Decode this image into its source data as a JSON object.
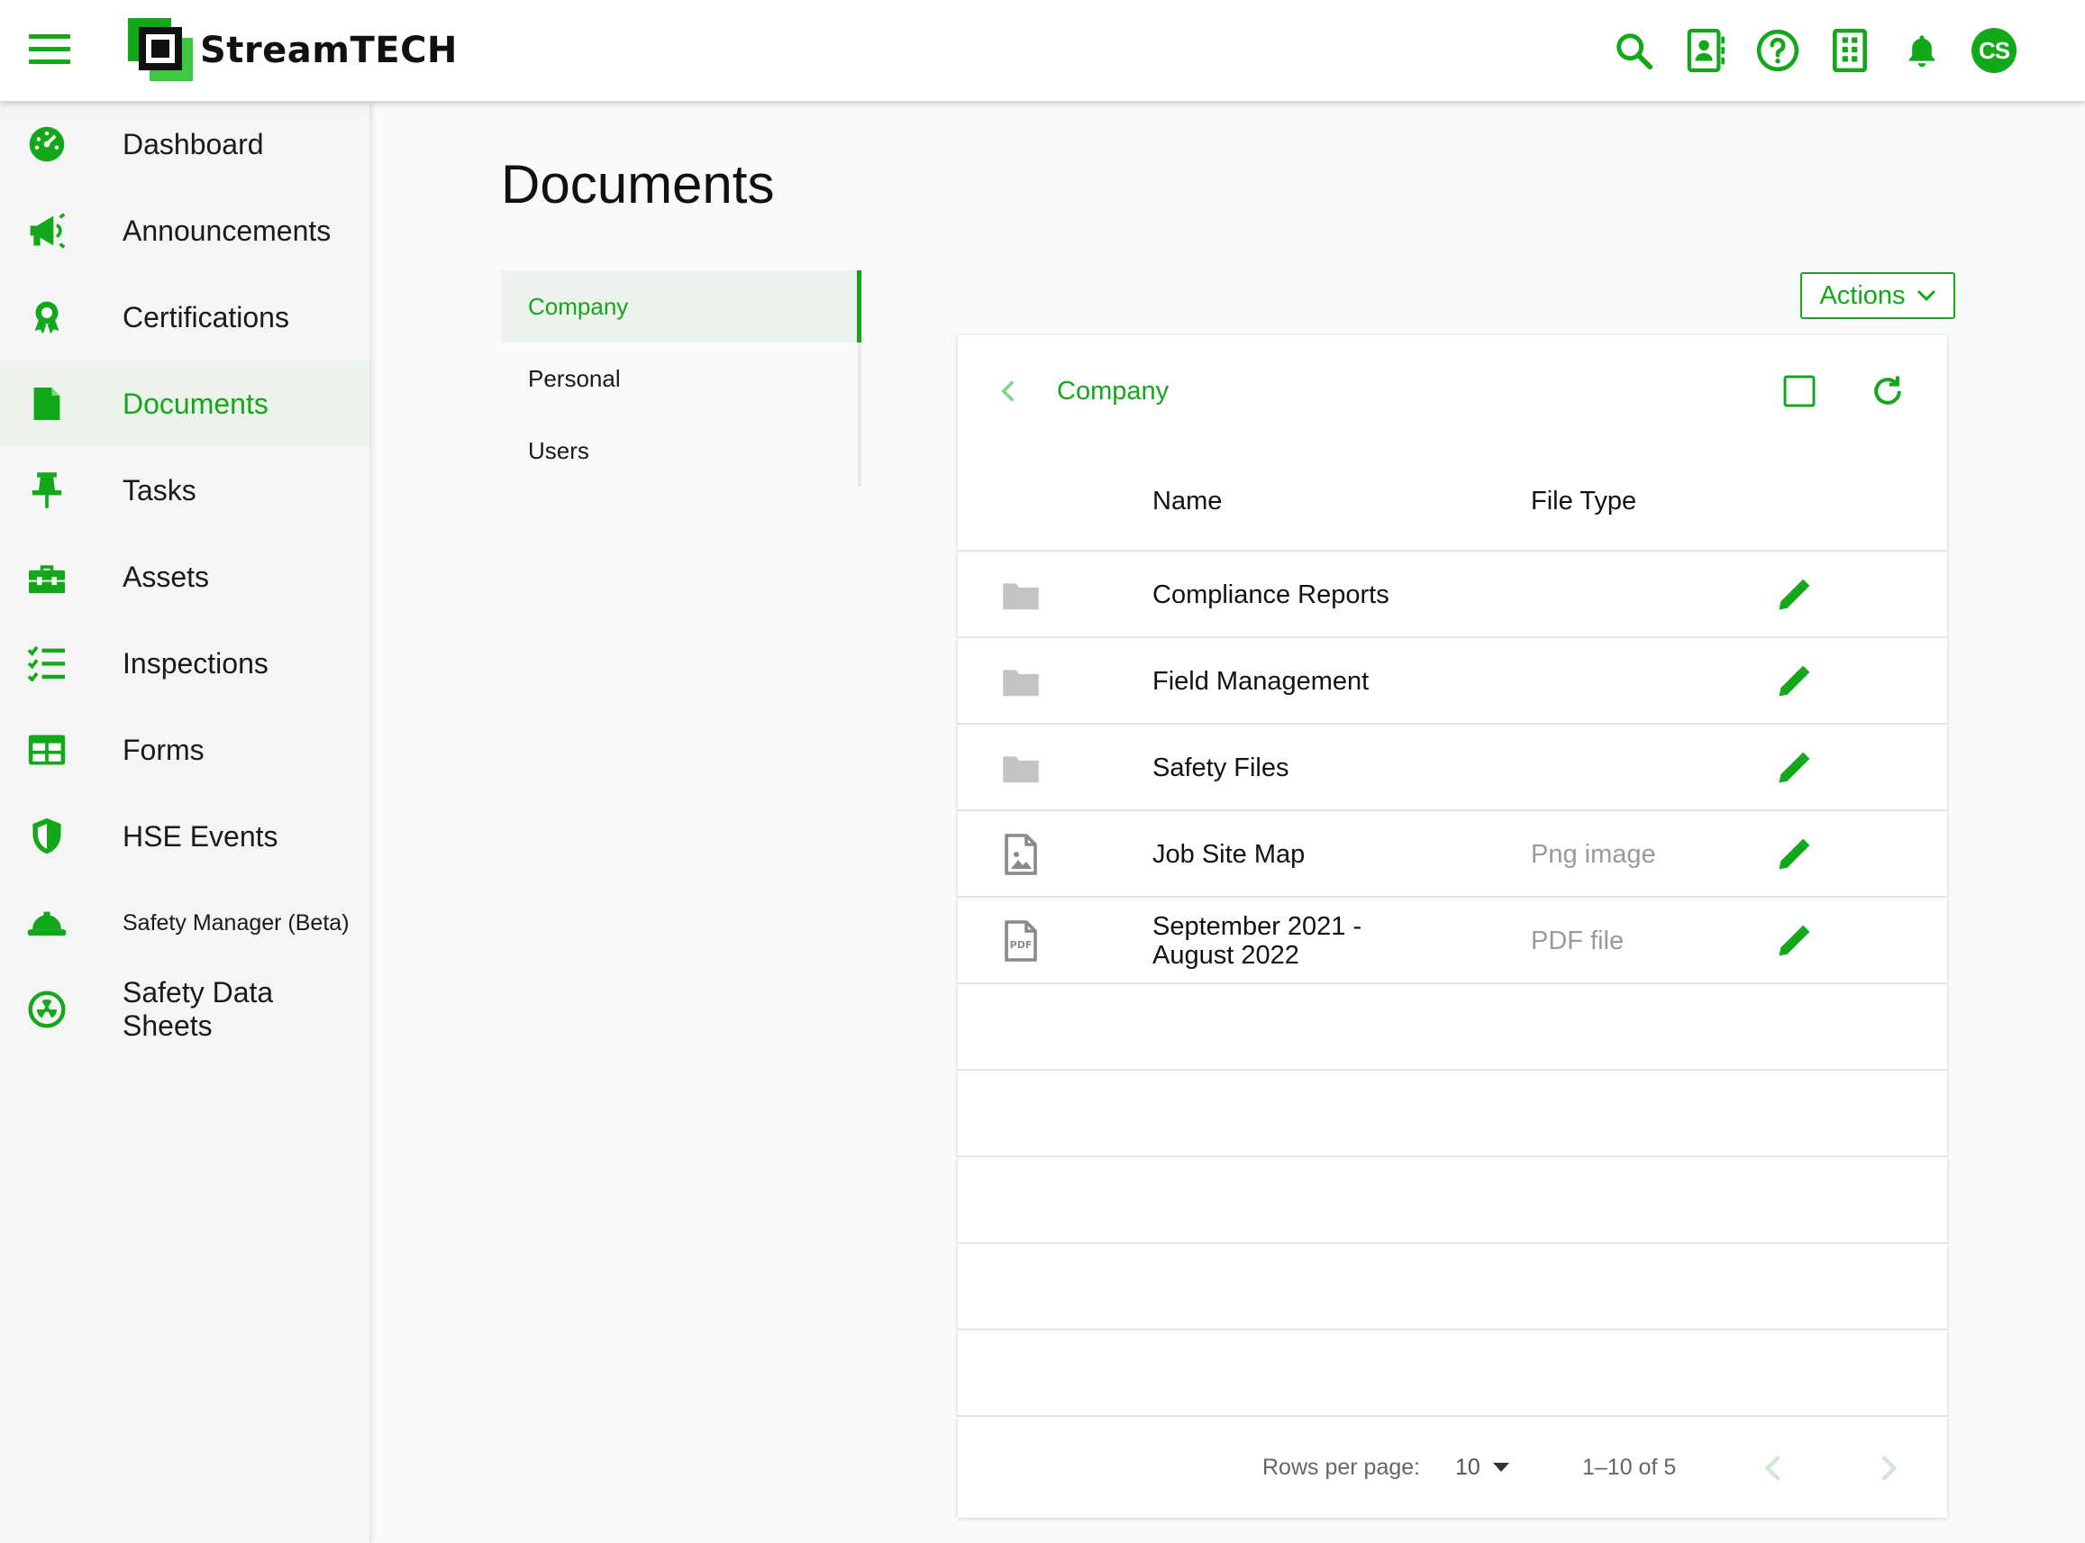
{
  "app": {
    "logo_text": "StreamTECH",
    "avatar_initials": "CS",
    "accent_color": "#13a819"
  },
  "topbar": {
    "icons": [
      "search-icon",
      "contact-card-icon",
      "help-icon",
      "building-icon",
      "bell-icon"
    ]
  },
  "sidebar": {
    "items": [
      {
        "label": "Dashboard",
        "icon": "dashboard-gauge-icon"
      },
      {
        "label": "Announcements",
        "icon": "megaphone-icon"
      },
      {
        "label": "Certifications",
        "icon": "award-icon"
      },
      {
        "label": "Documents",
        "icon": "document-icon",
        "active": true
      },
      {
        "label": "Tasks",
        "icon": "pushpin-icon"
      },
      {
        "label": "Assets",
        "icon": "toolbox-icon"
      },
      {
        "label": "Inspections",
        "icon": "checklist-icon"
      },
      {
        "label": "Forms",
        "icon": "table-icon"
      },
      {
        "label": "HSE Events",
        "icon": "shield-icon"
      },
      {
        "label": "Safety Manager (Beta)",
        "icon": "hard-hat-icon"
      },
      {
        "label": "Safety Data Sheets",
        "icon": "hazard-icon"
      }
    ]
  },
  "main": {
    "title": "Documents",
    "tabs": [
      {
        "label": "Company",
        "active": true
      },
      {
        "label": "Personal"
      },
      {
        "label": "Users"
      }
    ],
    "actions_label": "Actions"
  },
  "panel": {
    "breadcrumb": "Company",
    "columns": {
      "name": "Name",
      "file_type": "File Type"
    },
    "rows": [
      {
        "name": "Compliance Reports",
        "file_type": "",
        "icon": "folder-icon"
      },
      {
        "name": "Field Management",
        "file_type": "",
        "icon": "folder-icon"
      },
      {
        "name": "Safety Files",
        "file_type": "",
        "icon": "folder-icon"
      },
      {
        "name": "Job Site Map",
        "file_type": "Png image",
        "icon": "image-file-icon"
      },
      {
        "name_line1": "September 2021 -",
        "name_line2": "August 2022",
        "file_type": "PDF file",
        "icon": "pdf-file-icon",
        "pdf_badge": "PDF"
      }
    ],
    "footer": {
      "rows_per_page_label": "Rows per page:",
      "rows_per_page_value": "10",
      "range_text": "1–10 of 5"
    }
  }
}
